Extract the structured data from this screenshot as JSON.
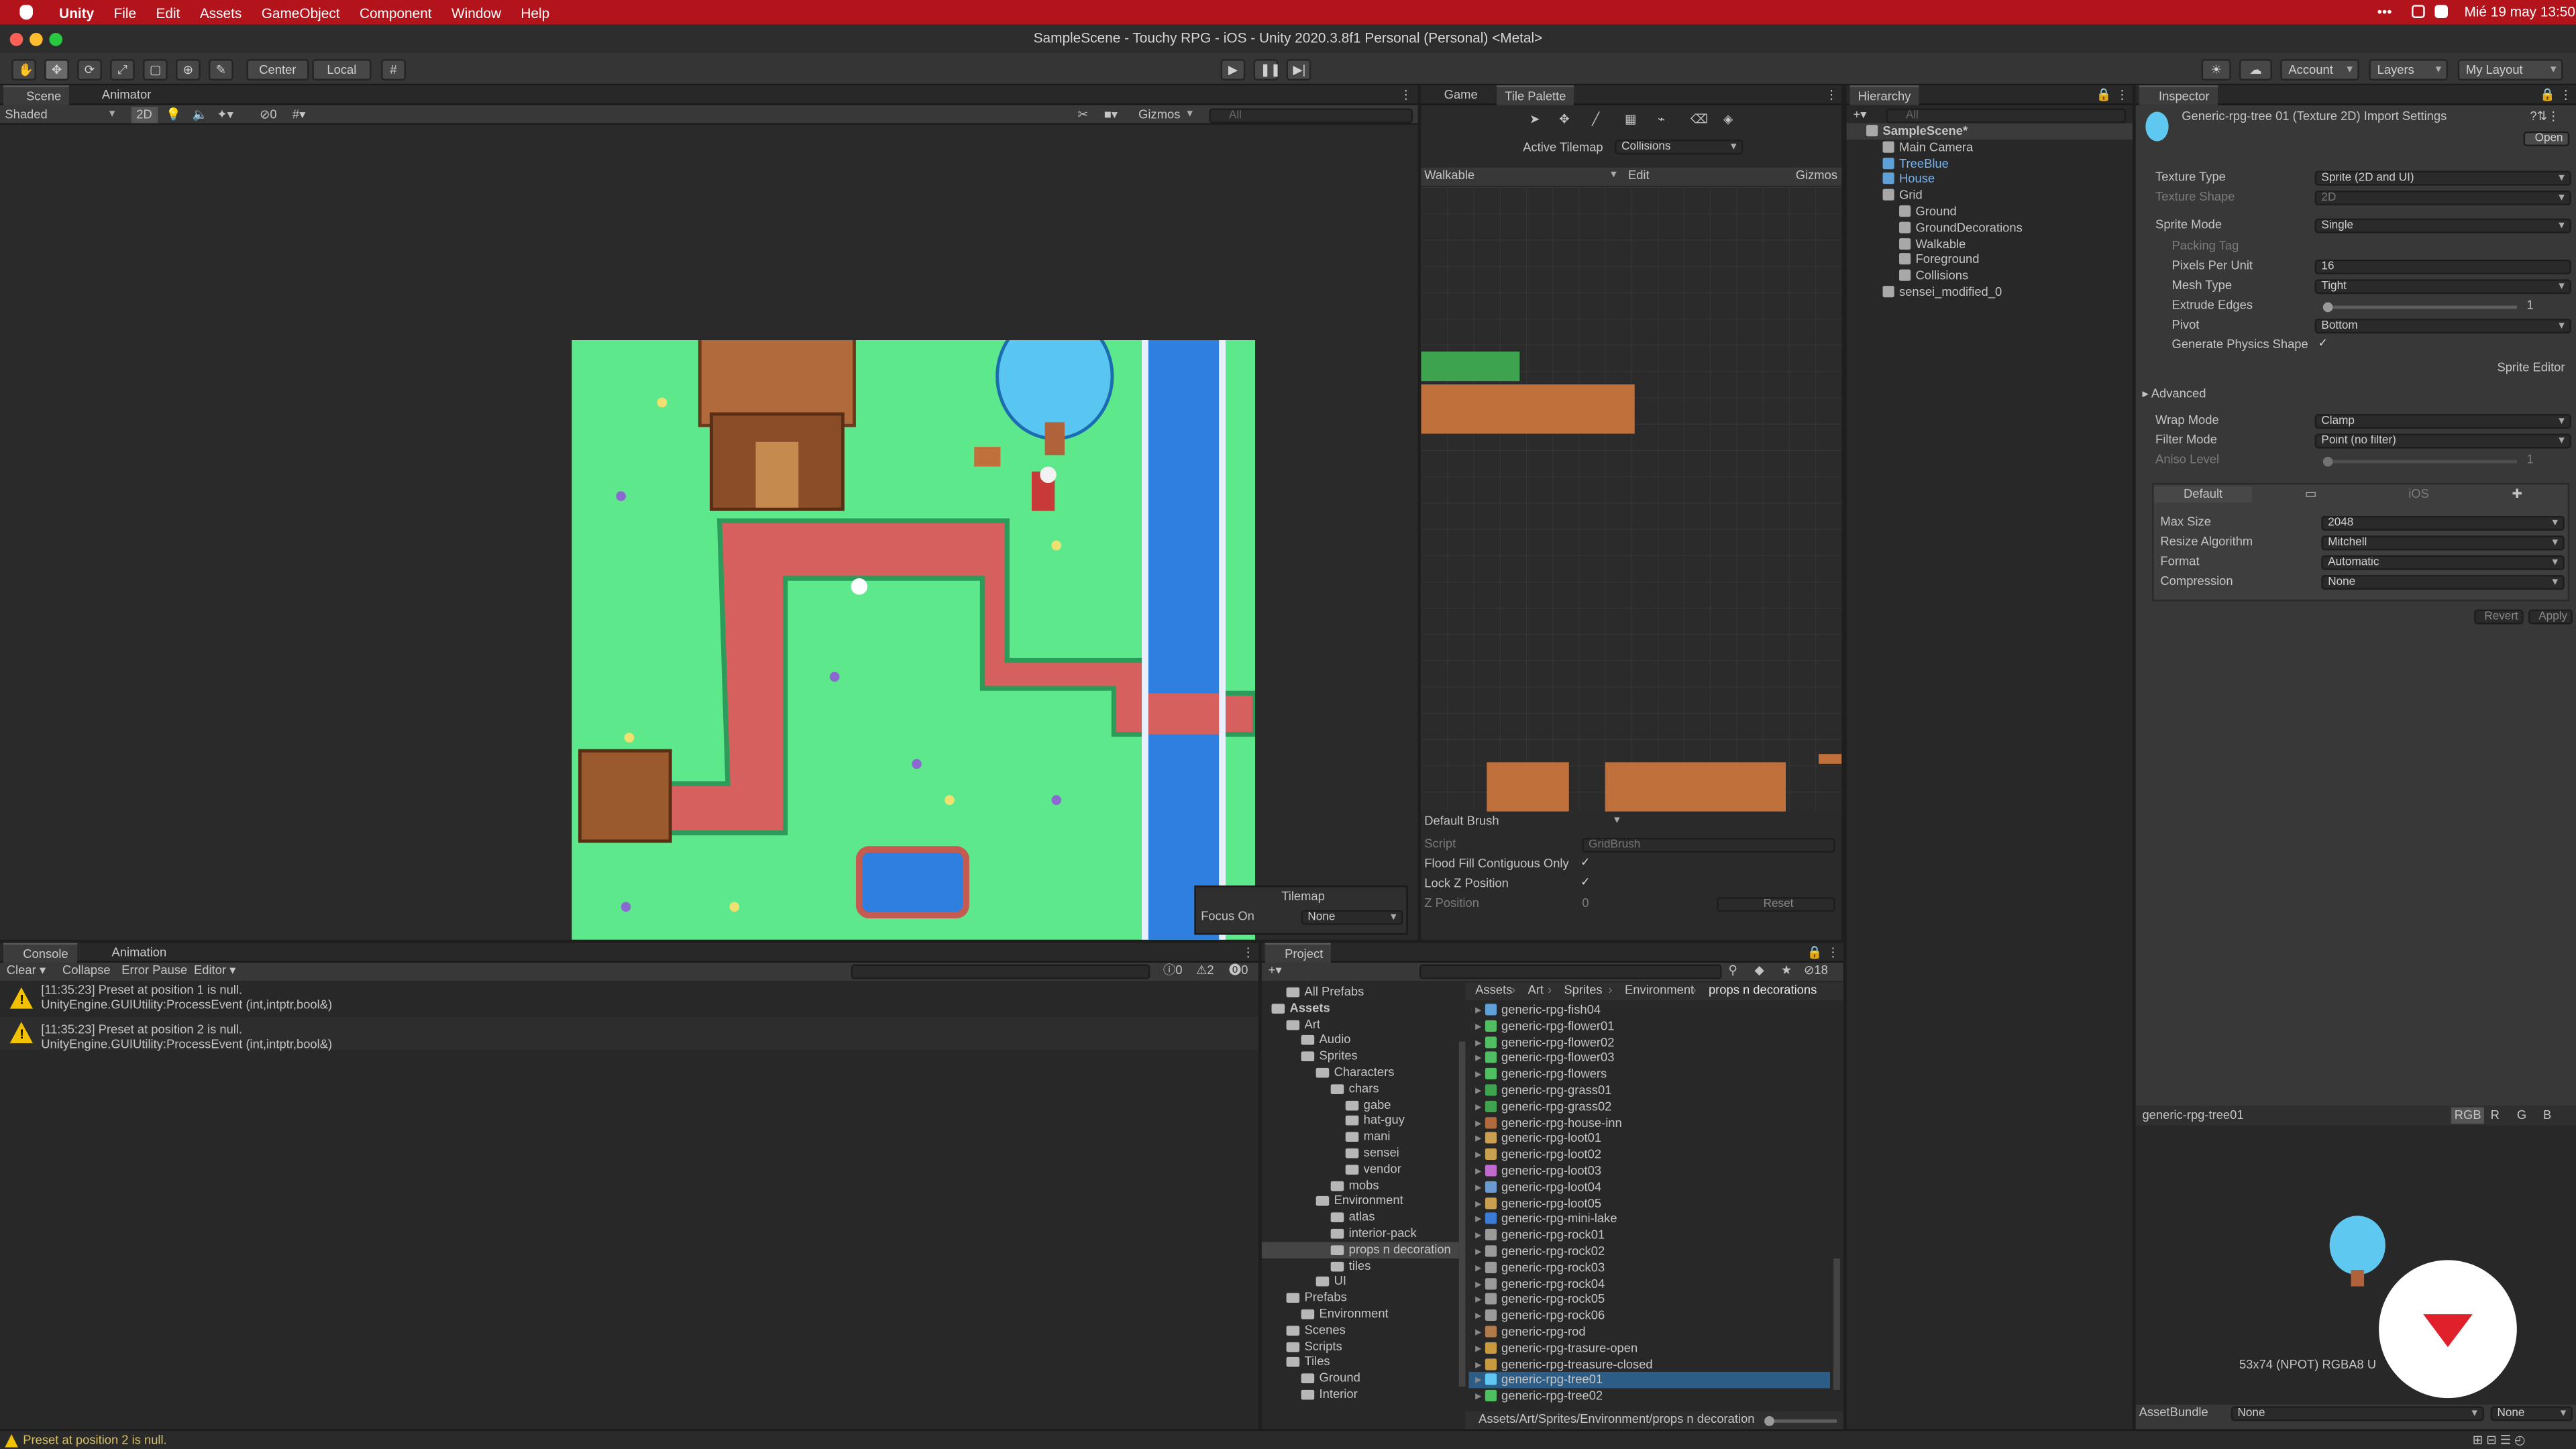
{
  "menubar": {
    "apple": "",
    "app": "Unity",
    "items": [
      "File",
      "Edit",
      "Assets",
      "GameObject",
      "Component",
      "Window",
      "Help"
    ],
    "clock": "Mié 19 may  13:50"
  },
  "titlebar": {
    "title": "SampleScene - Touchy RPG - iOS - Unity 2020.3.8f1 Personal (Personal) <Metal>"
  },
  "toolbar": {
    "center": "Center",
    "local": "Local",
    "account": "Account",
    "layers": "Layers",
    "layout": "My Layout"
  },
  "scene": {
    "tab_scene": "Scene",
    "tab_animator": "Animator",
    "shading": "Shaded",
    "mode_2d": "2D",
    "gizmos": "Gizmos",
    "search_placeholder": "All",
    "hidden_count": "0"
  },
  "tilemap_overlay": {
    "title": "Tilemap",
    "focus_label": "Focus On",
    "focus_value": "None"
  },
  "game": {
    "tab_game": "Game",
    "tab_palette": "Tile Palette",
    "active_tilemap_label": "Active Tilemap",
    "active_tilemap_value": "Collisions",
    "palette": "Walkable",
    "edit": "Edit",
    "gizmos": "Gizmos",
    "brush": "Default Brush",
    "script_label": "Script",
    "script_value": "GridBrush",
    "flood_label": "Flood Fill Contiguous Only",
    "lockz_label": "Lock Z Position",
    "zpos_label": "Z Position",
    "zpos_value": "0",
    "reset": "Reset"
  },
  "hierarchy": {
    "tab": "Hierarchy",
    "search_placeholder": "All",
    "items": [
      {
        "label": "SampleScene*",
        "indent": 0
      },
      {
        "label": "Main Camera",
        "indent": 1
      },
      {
        "label": "TreeBlue",
        "indent": 1,
        "prefab": true
      },
      {
        "label": "House",
        "indent": 1,
        "prefab": true
      },
      {
        "label": "Grid",
        "indent": 1
      },
      {
        "label": "Ground",
        "indent": 2
      },
      {
        "label": "GroundDecorations",
        "indent": 2
      },
      {
        "label": "Walkable",
        "indent": 2
      },
      {
        "label": "Foreground",
        "indent": 2
      },
      {
        "label": "Collisions",
        "indent": 2
      },
      {
        "label": "sensei_modified_0",
        "indent": 1
      }
    ]
  },
  "inspector": {
    "tab": "Inspector",
    "title": "Generic-rpg-tree 01 (Texture 2D) Import Settings",
    "open": "Open",
    "texture_type_label": "Texture Type",
    "texture_type": "Sprite (2D and UI)",
    "texture_shape_label": "Texture Shape",
    "texture_shape": "2D",
    "sprite_mode_label": "Sprite Mode",
    "sprite_mode": "Single",
    "packing_tag_label": "Packing Tag",
    "ppu_label": "Pixels Per Unit",
    "ppu": "16",
    "mesh_type_label": "Mesh Type",
    "mesh_type": "Tight",
    "extrude_label": "Extrude Edges",
    "extrude": "1",
    "extrude_fraction": 0.0,
    "pivot_label": "Pivot",
    "pivot": "Bottom",
    "physics_label": "Generate Physics Shape",
    "sprite_editor": "Sprite Editor",
    "advanced": "Advanced",
    "wrap_label": "Wrap Mode",
    "wrap": "Clamp",
    "filter_label": "Filter Mode",
    "filter": "Point (no filter)",
    "aniso_label": "Aniso Level",
    "aniso": "1",
    "platform_default": "Default",
    "platform_ios": "iOS",
    "max_size_label": "Max Size",
    "max_size": "2048",
    "resize_label": "Resize Algorithm",
    "resize": "Mitchell",
    "format_label": "Format",
    "format": "Automatic",
    "compression_label": "Compression",
    "compression": "None",
    "revert": "Revert",
    "apply": "Apply",
    "preview_name": "generic-rpg-tree01",
    "channels": [
      "RGB",
      "R",
      "G",
      "B"
    ],
    "preview_info": "53x74 (NPOT)  RGBA8 U",
    "assetbundle_label": "AssetBundle",
    "assetbundle": "None",
    "variant": "None"
  },
  "console": {
    "tab_console": "Console",
    "tab_animation": "Animation",
    "clear": "Clear",
    "collapse": "Collapse",
    "error_pause": "Error Pause",
    "editor": "Editor",
    "count_info": "0",
    "count_warn": "2",
    "count_err": "0",
    "logs": [
      {
        "line1": "[11:35:23] Preset at position 1 is null.",
        "line2": "UnityEngine.GUIUtility:ProcessEvent (int,intptr,bool&)"
      },
      {
        "line1": "[11:35:23] Preset at position 2 is null.",
        "line2": "UnityEngine.GUIUtility:ProcessEvent (int,intptr,bool&)"
      }
    ]
  },
  "project": {
    "tab": "Project",
    "hidden_count": "18",
    "breadcrumb": [
      "Assets",
      "Art",
      "Sprites",
      "Environment",
      "props n decorations"
    ],
    "tree": [
      {
        "label": "All Prefabs",
        "indent": 1
      },
      {
        "label": "Assets",
        "indent": 0,
        "bold": true
      },
      {
        "label": "Art",
        "indent": 1
      },
      {
        "label": "Audio",
        "indent": 2
      },
      {
        "label": "Sprites",
        "indent": 2
      },
      {
        "label": "Characters",
        "indent": 3
      },
      {
        "label": "chars",
        "indent": 4
      },
      {
        "label": "gabe",
        "indent": 5
      },
      {
        "label": "hat-guy",
        "indent": 5
      },
      {
        "label": "mani",
        "indent": 5
      },
      {
        "label": "sensei",
        "indent": 5
      },
      {
        "label": "vendor",
        "indent": 5
      },
      {
        "label": "mobs",
        "indent": 4
      },
      {
        "label": "Environment",
        "indent": 3
      },
      {
        "label": "atlas",
        "indent": 4
      },
      {
        "label": "interior-pack",
        "indent": 4
      },
      {
        "label": "props n decoration",
        "indent": 4,
        "selected": true
      },
      {
        "label": "tiles",
        "indent": 4
      },
      {
        "label": "UI",
        "indent": 3
      },
      {
        "label": "Prefabs",
        "indent": 1
      },
      {
        "label": "Environment",
        "indent": 2
      },
      {
        "label": "Scenes",
        "indent": 1
      },
      {
        "label": "Scripts",
        "indent": 1
      },
      {
        "label": "Tiles",
        "indent": 1
      },
      {
        "label": "Ground",
        "indent": 2
      },
      {
        "label": "Interior",
        "indent": 2
      }
    ],
    "assets": [
      {
        "label": "generic-rpg-fish04",
        "color": "#5ea0d8"
      },
      {
        "label": "generic-rpg-flower01",
        "color": "#4fbf62"
      },
      {
        "label": "generic-rpg-flower02",
        "color": "#4fbf62"
      },
      {
        "label": "generic-rpg-flower03",
        "color": "#4fbf62"
      },
      {
        "label": "generic-rpg-flowers",
        "color": "#4fbf62"
      },
      {
        "label": "generic-rpg-grass01",
        "color": "#3da34e"
      },
      {
        "label": "generic-rpg-grass02",
        "color": "#3da34e"
      },
      {
        "label": "generic-rpg-house-inn",
        "color": "#b06a3b"
      },
      {
        "label": "generic-rpg-loot01",
        "color": "#c8a050"
      },
      {
        "label": "generic-rpg-loot02",
        "color": "#c8a050"
      },
      {
        "label": "generic-rpg-loot03",
        "color": "#c06ad0"
      },
      {
        "label": "generic-rpg-loot04",
        "color": "#6a9ad0"
      },
      {
        "label": "generic-rpg-loot05",
        "color": "#c8a050"
      },
      {
        "label": "generic-rpg-mini-lake",
        "color": "#3a7bd8"
      },
      {
        "label": "generic-rpg-rock01",
        "color": "#9a9a9a"
      },
      {
        "label": "generic-rpg-rock02",
        "color": "#9a9a9a"
      },
      {
        "label": "generic-rpg-rock03",
        "color": "#9a9a9a"
      },
      {
        "label": "generic-rpg-rock04",
        "color": "#9a9a9a"
      },
      {
        "label": "generic-rpg-rock05",
        "color": "#9a9a9a"
      },
      {
        "label": "generic-rpg-rock06",
        "color": "#9a9a9a"
      },
      {
        "label": "generic-rpg-rod",
        "color": "#b07a4a"
      },
      {
        "label": "generic-rpg-trasure-open",
        "color": "#c89a40"
      },
      {
        "label": "generic-rpg-treasure-closed",
        "color": "#c89a40"
      },
      {
        "label": "generic-rpg-tree01",
        "color": "#5ec8f0",
        "selected": true
      },
      {
        "label": "generic-rpg-tree02",
        "color": "#4fbf62"
      }
    ],
    "path": "Assets/Art/Sprites/Environment/props n decoration"
  },
  "status": {
    "message": "Preset at position 2 is null."
  },
  "colors": {
    "menubar": "#b3131a",
    "grass": "#5ee88c",
    "path": "#d6605e",
    "water": "#2f7fe0",
    "selection": "#2c5d87"
  }
}
